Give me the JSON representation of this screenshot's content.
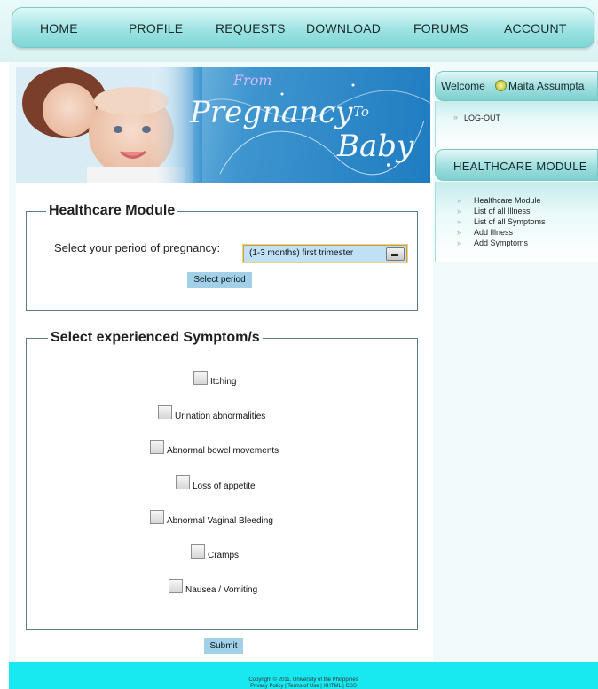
{
  "nav": {
    "items": [
      "HOME",
      "PROFILE",
      "REQUESTS",
      "DOWNLOAD",
      "FORUMS",
      "ACCOUNT"
    ]
  },
  "banner": {
    "line1": "From",
    "line2": "Pregnancy",
    "line3": "To",
    "line4": "Baby"
  },
  "healthcare_form": {
    "legend": "Healthcare Module",
    "period_label": "Select your period of pregnancy:",
    "period_selected": "(1-3 months) first trimester",
    "select_button": "Select period"
  },
  "symptoms_form": {
    "legend": "Select experienced Symptom/s",
    "items": [
      "Itching",
      "Urination abnormalities",
      "Abnormal bowel movements",
      "Loss of appetite",
      "Abnormal Vaginal Bleeding",
      "Cramps",
      "Nausea / Vomiting"
    ],
    "submit_button": "Submit"
  },
  "sidebar": {
    "welcome_prefix": "Welcome",
    "user_name": "Maita Assumpta",
    "logout": "LOG-OUT",
    "module_title": "HEALTHCARE MODULE",
    "links": [
      "Healthcare Module",
      "List of all Illness",
      "List of all Symptoms",
      "Add Illness",
      "Add Symptoms"
    ]
  },
  "footer": {
    "copyright": "Copyright © 2011. University of the Philippines",
    "links": "Privacy Policy | Terms of Use | XHTML | CSS"
  },
  "colors": {
    "nav_bar": "#9ee3e3",
    "footer": "#18e8f0",
    "button": "#9fd2ea",
    "banner_blue": "#1f7cc0"
  }
}
